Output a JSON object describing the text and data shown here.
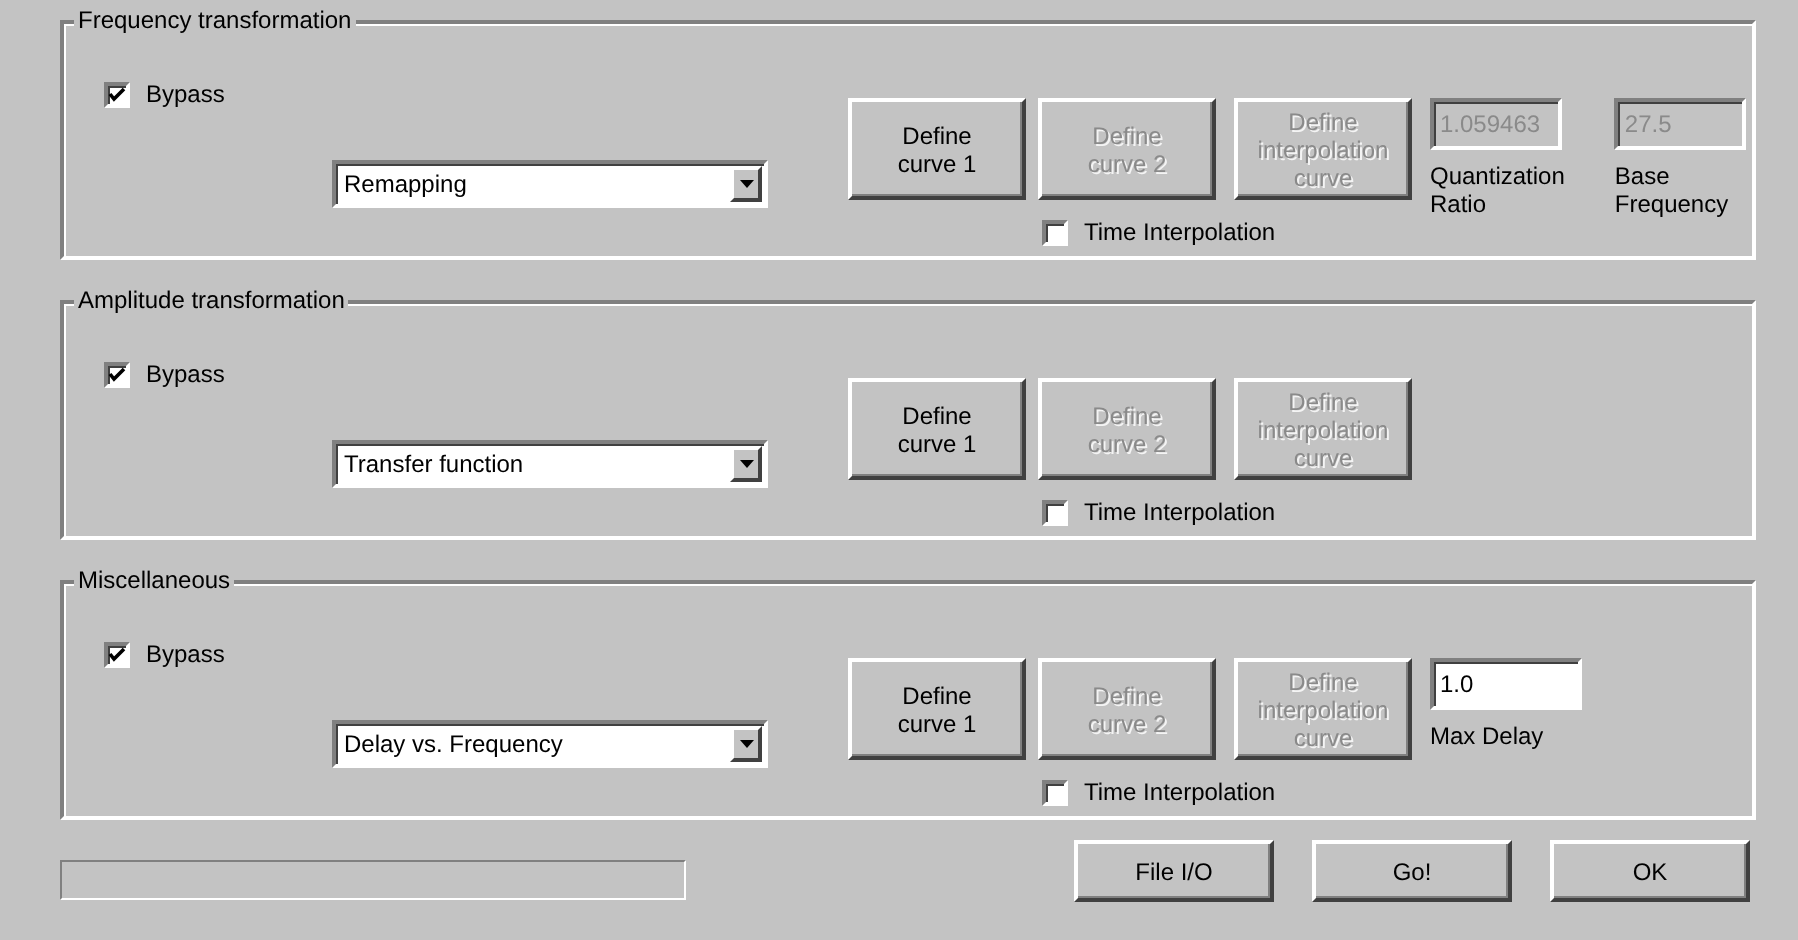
{
  "groups": [
    {
      "title": "Frequency transformation",
      "bypass": {
        "label": "Bypass",
        "checked": true
      },
      "mode": {
        "value": "Remapping"
      },
      "buttons": [
        {
          "label": "Define\ncurve 1",
          "disabled": false
        },
        {
          "label": "Define\ncurve 2",
          "disabled": true
        },
        {
          "label": "Define\ninterpolation\ncurve",
          "disabled": true
        }
      ],
      "time_interpolation": {
        "label": "Time Interpolation",
        "checked": false
      },
      "fields": [
        {
          "value": "1.059463",
          "label": "Quantization\nRatio",
          "disabled": true
        },
        {
          "value": "27.5",
          "label": "Base\nFrequency",
          "disabled": true
        }
      ]
    },
    {
      "title": "Amplitude transformation",
      "bypass": {
        "label": "Bypass",
        "checked": true
      },
      "mode": {
        "value": "Transfer function"
      },
      "buttons": [
        {
          "label": "Define\ncurve 1",
          "disabled": false
        },
        {
          "label": "Define\ncurve 2",
          "disabled": true
        },
        {
          "label": "Define\ninterpolation\ncurve",
          "disabled": true
        }
      ],
      "time_interpolation": {
        "label": "Time Interpolation",
        "checked": false
      }
    },
    {
      "title": "Miscellaneous",
      "bypass": {
        "label": "Bypass",
        "checked": true
      },
      "mode": {
        "value": "Delay vs. Frequency"
      },
      "buttons": [
        {
          "label": "Define\ncurve 1",
          "disabled": false
        },
        {
          "label": "Define\ncurve 2",
          "disabled": true
        },
        {
          "label": "Define\ninterpolation\ncurve",
          "disabled": true
        }
      ],
      "time_interpolation": {
        "label": "Time Interpolation",
        "checked": false
      },
      "fields": [
        {
          "value": "1.0",
          "label": "Max Delay",
          "disabled": false
        }
      ]
    }
  ],
  "progress": {
    "level": 0
  },
  "buttons": [
    "File I/O",
    "Go!",
    "OK"
  ]
}
